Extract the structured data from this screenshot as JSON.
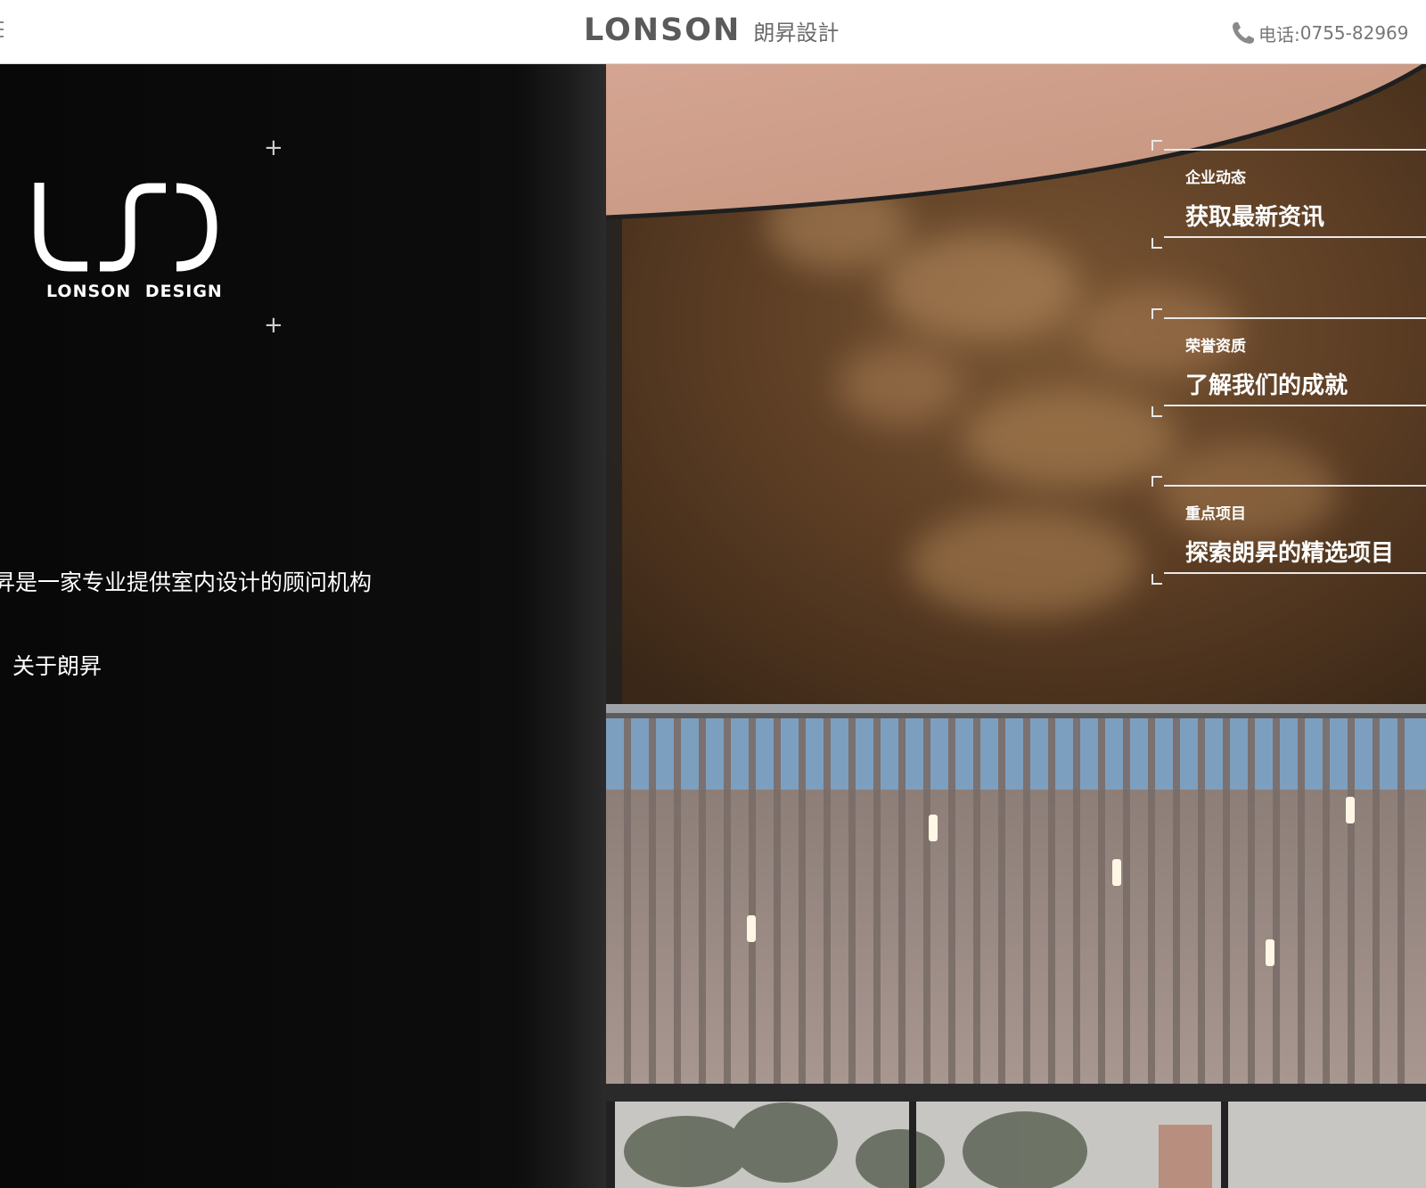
{
  "header": {
    "brand_en": "LONSON",
    "brand_cn": "朗昇設計",
    "phone_label": "电话:",
    "phone_number": "0755-82969"
  },
  "logo": {
    "text": "LONSON  DESIGN"
  },
  "intro": {
    "tagline": "昇是一家专业提供室内设计的顾问机构",
    "about_link": "关于朗昇"
  },
  "cards": [
    {
      "label": "企业动态",
      "title": "获取最新资讯"
    },
    {
      "label": "荣誉资质",
      "title": "了解我们的成就"
    },
    {
      "label": "重点项目",
      "title": "探索朗昇的精选项目"
    }
  ],
  "colors": {
    "header_bg": "#ffffff",
    "brand_text": "#5a5a5a",
    "panel_bg": "#0a0a0a",
    "wall_brown": "#6b4a2e",
    "ceiling_pink": "#d9a892",
    "card_line": "#e8e8e8"
  },
  "icons": {
    "menu": "menu-icon",
    "phone": "phone-icon",
    "plus": "plus-icon"
  }
}
